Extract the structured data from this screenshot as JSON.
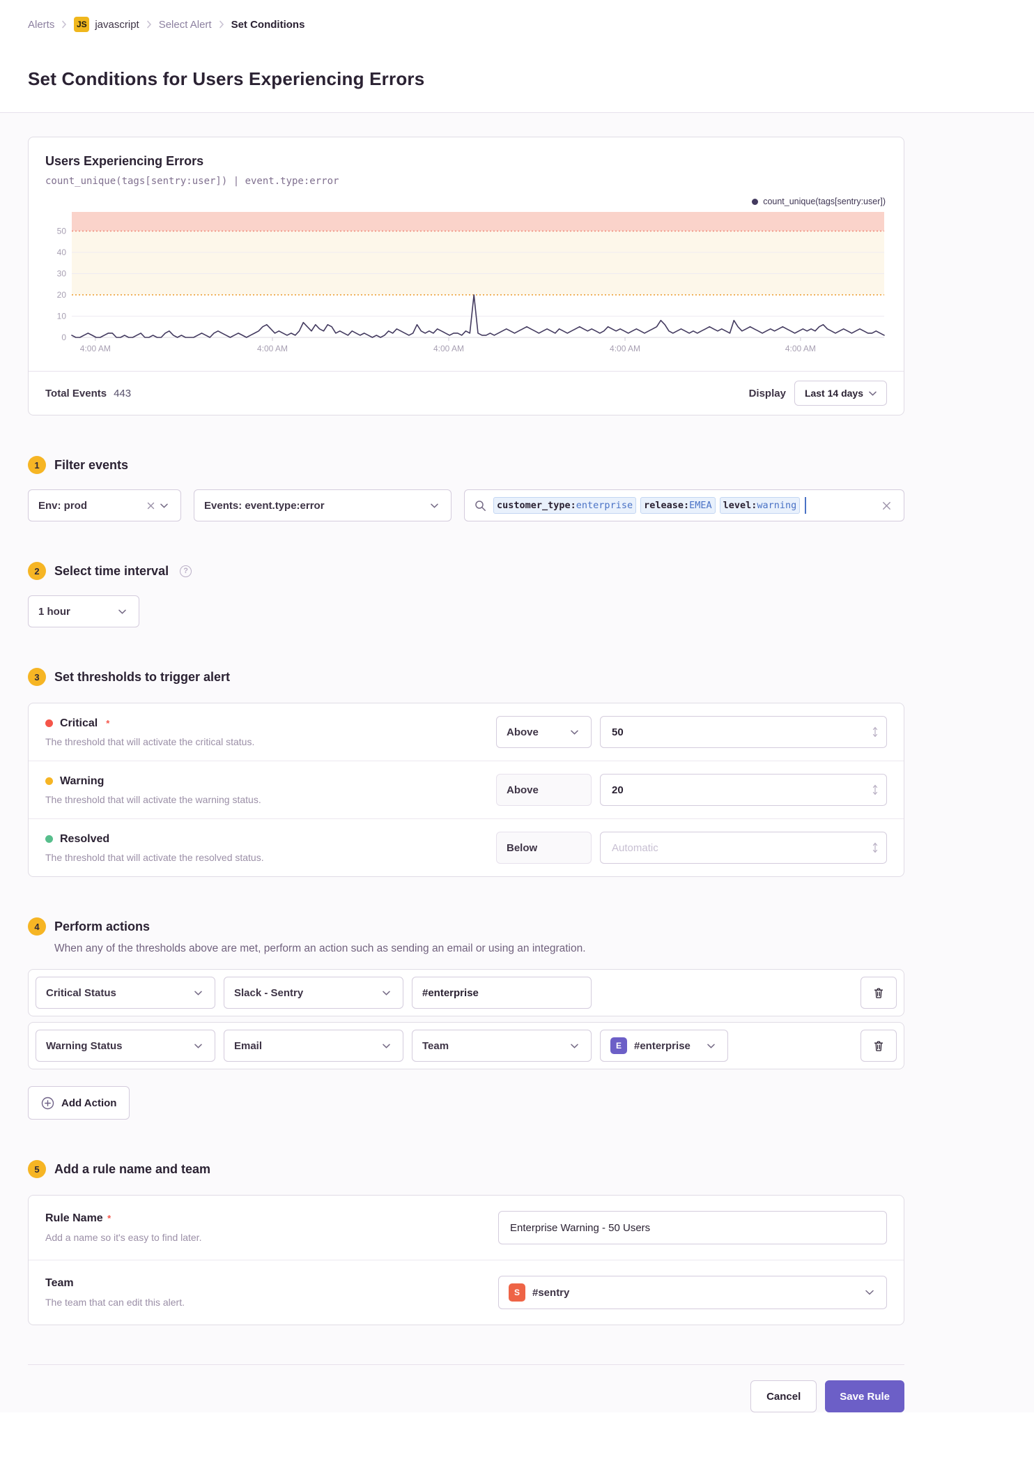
{
  "breadcrumb": {
    "alerts": "Alerts",
    "project_badge": "JS",
    "project": "javascript",
    "select_alert": "Select Alert",
    "set_conditions": "Set Conditions"
  },
  "page": {
    "title": "Set Conditions for Users Experiencing Errors"
  },
  "chart_panel": {
    "title": "Users Experiencing Errors",
    "query": "count_unique(tags[sentry:user]) | event.type:error",
    "legend": "count_unique(tags[sentry:user])",
    "total_events_label": "Total Events",
    "total_events_value": "443",
    "display_label": "Display",
    "range_button": "Last 14 days"
  },
  "chart_data": {
    "type": "line",
    "title": "Users Experiencing Errors",
    "query": "count_unique(tags[sentry:user]) | event.type:error",
    "legend_entries": [
      "count_unique(tags[sentry:user])"
    ],
    "ylim": [
      0,
      59
    ],
    "y_ticks": [
      0,
      10,
      20,
      30,
      40,
      50
    ],
    "x_tick_labels": [
      "4:00 AM",
      "4:00 AM",
      "4:00 AM",
      "4:00 AM",
      "4:00 AM"
    ],
    "x_tick_fracs": [
      0.029,
      0.247,
      0.464,
      0.681,
      0.897
    ],
    "thresholds": {
      "critical": 50,
      "warning": 20
    },
    "band_colors": {
      "critical": "#fad3ca",
      "warning": "#fdf7ea"
    },
    "threshold_line_colors": {
      "critical": "#f0907e",
      "warning": "#eda23b"
    },
    "line_color": "#433a5f",
    "grid": true,
    "legend_position": "top-right",
    "values": [
      1,
      0,
      0,
      1,
      2,
      1,
      0,
      0,
      1,
      2,
      2,
      0,
      0,
      1,
      0,
      0,
      1,
      2,
      0,
      0,
      1,
      0,
      0,
      2,
      3,
      1,
      0,
      1,
      0,
      0,
      0,
      1,
      2,
      1,
      0,
      2,
      3,
      2,
      1,
      0,
      1,
      2,
      1,
      0,
      1,
      2,
      3,
      5,
      6,
      4,
      2,
      3,
      2,
      1,
      2,
      1,
      3,
      7,
      5,
      3,
      6,
      4,
      3,
      6,
      5,
      2,
      3,
      2,
      1,
      3,
      2,
      1,
      2,
      1,
      0,
      1,
      0,
      1,
      3,
      2,
      4,
      3,
      2,
      1,
      2,
      6,
      3,
      2,
      3,
      2,
      4,
      3,
      2,
      1,
      2,
      2,
      1,
      3,
      2,
      20,
      2,
      1,
      1,
      2,
      1,
      2,
      3,
      4,
      3,
      2,
      3,
      4,
      5,
      4,
      3,
      2,
      3,
      4,
      3,
      2,
      4,
      3,
      2,
      3,
      4,
      5,
      4,
      3,
      4,
      3,
      2,
      3,
      5,
      4,
      3,
      4,
      3,
      2,
      3,
      4,
      3,
      2,
      3,
      4,
      5,
      8,
      6,
      3,
      2,
      3,
      4,
      3,
      2,
      3,
      2,
      3,
      4,
      5,
      4,
      3,
      4,
      3,
      2,
      8,
      5,
      3,
      4,
      5,
      4,
      3,
      2,
      3,
      4,
      3,
      4,
      5,
      4,
      3,
      2,
      3,
      4,
      3,
      4,
      3,
      5,
      6,
      4,
      3,
      2,
      3,
      4,
      3,
      2,
      3,
      4,
      3,
      2,
      2,
      3,
      2,
      1
    ]
  },
  "sections": {
    "filter": {
      "number": "1",
      "title": "Filter events",
      "env_value": "Env: prod",
      "events_value": "Events: event.type:error",
      "search_tokens": [
        {
          "key": "customer_type:",
          "value": "enterprise"
        },
        {
          "key": "release:",
          "value": "EMEA"
        },
        {
          "key": "level:",
          "value": "warning"
        }
      ]
    },
    "interval": {
      "number": "2",
      "title": "Select time interval",
      "value": "1 hour"
    },
    "thresholds": {
      "number": "3",
      "title": "Set thresholds to trigger alert",
      "rows": [
        {
          "label": "Critical",
          "required": "*",
          "desc": "The threshold that will activate the critical status.",
          "op": "Above",
          "value": "50"
        },
        {
          "label": "Warning",
          "required": "",
          "desc": "The threshold that will activate the warning status.",
          "op": "Above",
          "value": "20"
        },
        {
          "label": "Resolved",
          "required": "",
          "desc": "The threshold that will activate the resolved status.",
          "op": "Below",
          "placeholder": "Automatic"
        }
      ]
    },
    "actions": {
      "number": "4",
      "title": "Perform actions",
      "desc": "When any of the thresholds above are met, perform an action such as sending an email or using an integration.",
      "rows": [
        {
          "status": "Critical Status",
          "target": "Slack - Sentry",
          "channel": "#enterprise"
        },
        {
          "status": "Warning Status",
          "target": "Email",
          "member_type": "Team",
          "team_badge": "E",
          "team_value": "#enterprise"
        }
      ],
      "add_button": "Add Action"
    },
    "rule": {
      "number": "5",
      "title": "Add a rule name and team",
      "name_label": "Rule Name",
      "name_required": "*",
      "name_help": "Add a name so it's easy to find later.",
      "name_value": "Enterprise Warning - 50 Users",
      "team_label": "Team",
      "team_help": "The team that can edit this alert.",
      "team_badge": "S",
      "team_value": "#sentry"
    }
  },
  "footer": {
    "cancel": "Cancel",
    "save": "Save Rule"
  },
  "colors": {
    "accent": "#6c5fc7",
    "critical": "#f55549",
    "warning": "#f6b524",
    "resolved": "#57be8c",
    "step_badge": "#f6b524",
    "js_badge": "#f0b71d",
    "team_e_badge": "#6c5fc7",
    "team_s_badge": "#ee6446"
  }
}
